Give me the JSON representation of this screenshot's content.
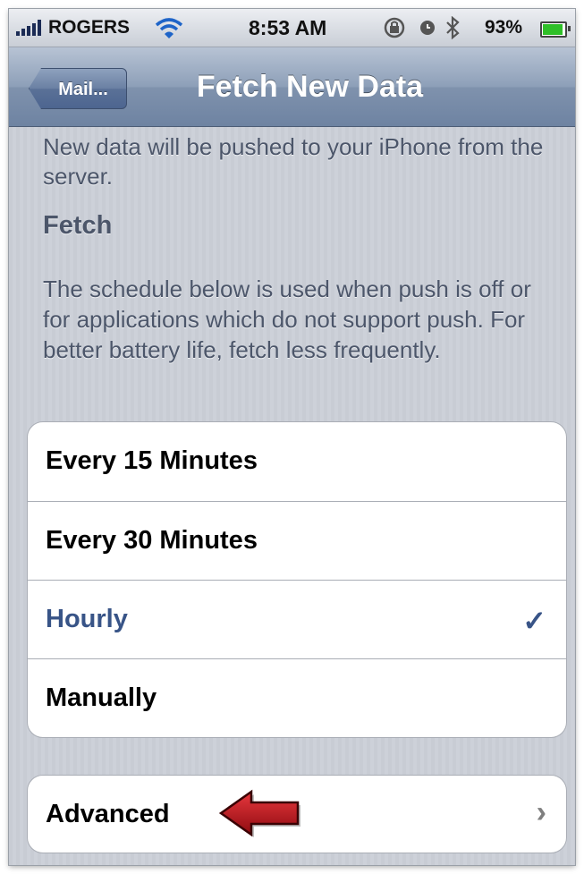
{
  "status_bar": {
    "carrier": "ROGERS",
    "time": "8:53 AM",
    "battery_percent": "93%",
    "battery_level": 0.93,
    "icons": [
      "signal-bars-icon",
      "wifi-icon",
      "lock-rotation-icon",
      "alarm-icon",
      "bluetooth-icon",
      "battery-icon"
    ]
  },
  "nav": {
    "back_label": "Mail...",
    "title": "Fetch New Data"
  },
  "push_description": "New data will be pushed to your iPhone from the server.",
  "fetch": {
    "heading": "Fetch",
    "description": "The schedule below is used when push is off or for applications which do not support push. For better battery life, fetch less frequently.",
    "options": [
      {
        "label": "Every 15 Minutes",
        "selected": false
      },
      {
        "label": "Every 30 Minutes",
        "selected": false
      },
      {
        "label": "Hourly",
        "selected": true
      },
      {
        "label": "Manually",
        "selected": false
      }
    ]
  },
  "advanced": {
    "label": "Advanced"
  },
  "colors": {
    "selected_text": "#385487",
    "annotation_arrow": "#c0141a"
  }
}
